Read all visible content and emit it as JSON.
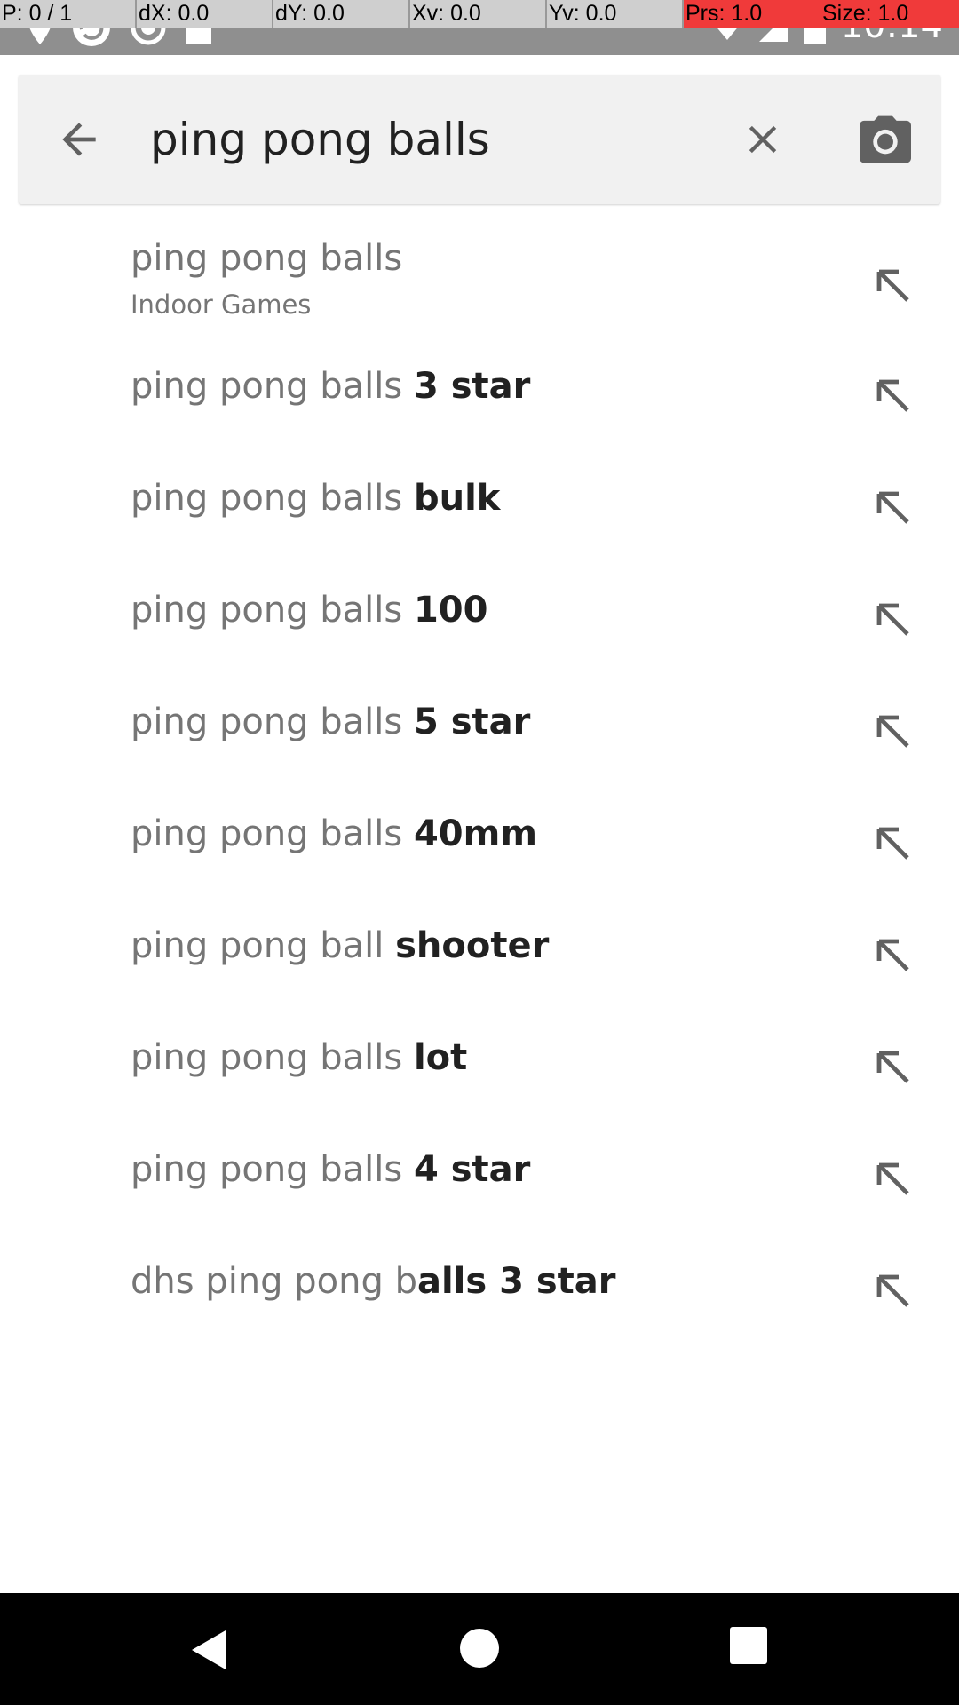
{
  "status_bar": {
    "time": "10:14",
    "pointer_overlay": {
      "p": "P: 0 / 1",
      "dx": "dX: 0.0",
      "dy": "dY: 0.0",
      "xv": "Xv: 0.0",
      "yv": "Yv: 0.0",
      "prs": "Prs: 1.0",
      "size": "Size: 1.0"
    },
    "alert_color": "#f03a3a"
  },
  "search": {
    "query": "ping pong balls",
    "back_icon": "arrow-back-icon",
    "clear_icon": "close-icon",
    "camera_icon": "camera-icon"
  },
  "suggestions": [
    {
      "prefix": "ping pong balls",
      "bold": "",
      "subtitle": "Indoor Games"
    },
    {
      "prefix": "ping pong balls ",
      "bold": "3 star"
    },
    {
      "prefix": "ping pong balls ",
      "bold": "bulk"
    },
    {
      "prefix": "ping pong balls ",
      "bold": "100"
    },
    {
      "prefix": "ping pong balls ",
      "bold": "5 star"
    },
    {
      "prefix": "ping pong balls ",
      "bold": "40mm"
    },
    {
      "prefix": "ping pong ball ",
      "bold": "shooter"
    },
    {
      "prefix": "ping pong balls ",
      "bold": "lot"
    },
    {
      "prefix": "ping pong balls ",
      "bold": "4 star"
    },
    {
      "prefix": "dhs ping pong b",
      "bold": "alls 3 star"
    }
  ],
  "suggestion_fill_icon": "arrow-up-left-icon",
  "nav_bar": {
    "back_icon": "nav-back-icon",
    "home_icon": "nav-home-icon",
    "recents_icon": "nav-recents-icon"
  }
}
